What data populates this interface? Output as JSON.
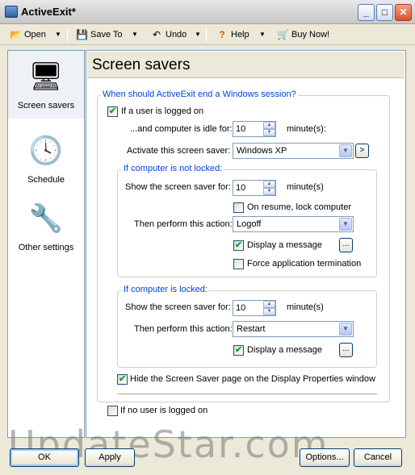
{
  "window": {
    "title": "ActiveExit*"
  },
  "toolbar": {
    "open": "Open",
    "save_to": "Save To",
    "undo": "Undo",
    "help": "Help",
    "buy_now": "Buy Now!"
  },
  "nav": {
    "items": [
      {
        "label": "Screen savers",
        "icon": "monitor-icon"
      },
      {
        "label": "Schedule",
        "icon": "clock-scroll-icon"
      },
      {
        "label": "Other settings",
        "icon": "tools-icon"
      }
    ]
  },
  "page": {
    "title": "Screen savers",
    "group_main": {
      "legend": "When should ActiveExit end a Windows session?",
      "user_logged_on_label": "If a user is logged on",
      "user_logged_on_checked": true,
      "idle_label": "...and computer is idle for:",
      "idle_value": "10",
      "idle_unit": "minute(s):",
      "activate_label": "Activate this screen saver:",
      "activate_value": "Windows XP"
    },
    "not_locked": {
      "legend": "If computer is not locked:",
      "show_label": "Show the screen saver for:",
      "show_value": "10",
      "show_unit": "minute(s)",
      "resume_lock_label": "On resume, lock computer",
      "resume_lock_checked": false,
      "action_label": "Then perform this action:",
      "action_value": "Logoff",
      "display_msg_label": "Display a message",
      "display_msg_checked": true,
      "force_label": "Force application termination",
      "force_checked": false
    },
    "locked": {
      "legend": "If computer is locked:",
      "show_label": "Show the screen saver for:",
      "show_value": "10",
      "show_unit": "minute(s)",
      "action_label": "Then perform this action:",
      "action_value": "Restart",
      "display_msg_label": "Display a message",
      "display_msg_checked": true
    },
    "hide_page_label": "Hide the Screen Saver page on the Display Properties window",
    "hide_page_checked": true,
    "no_user_label": "If no user is logged on",
    "no_user_checked": false
  },
  "buttons": {
    "ok": "OK",
    "apply": "Apply",
    "options": "Options...",
    "cancel": "Cancel",
    "ellipsis": "...",
    "arrow": ">"
  },
  "watermark": "UpdateStar.com"
}
